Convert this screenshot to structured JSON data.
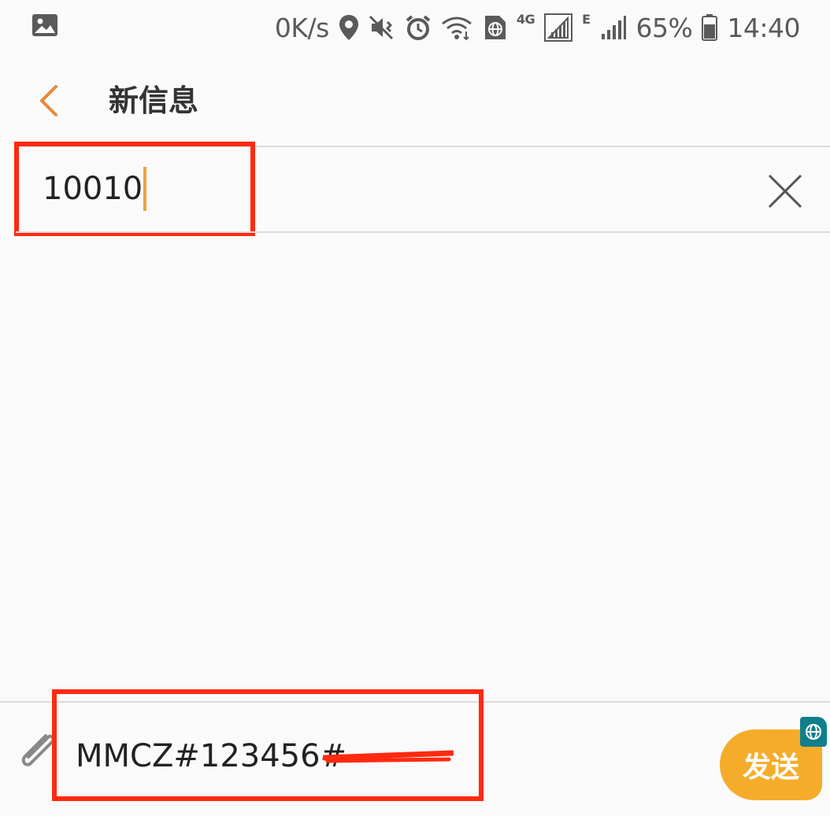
{
  "status_bar": {
    "net_speed": "0K/s",
    "network_4g": "4G",
    "network_e": "E",
    "battery_percent": "65%",
    "time": "14:40",
    "icons": [
      "image-icon",
      "location-icon",
      "vibrate-icon",
      "alarm-icon",
      "wifi-icon",
      "globe-sim-icon",
      "signal-icon",
      "signal-icon-2",
      "battery-icon"
    ]
  },
  "header": {
    "title": "新信息"
  },
  "recipient": {
    "value": "10010"
  },
  "composer": {
    "message_value": "MMCZ#123456#",
    "send_label": "发送"
  },
  "colors": {
    "accent": "#e8883a",
    "send_button": "#f6ac2b",
    "annotation_red": "#ff2a10",
    "sim_badge": "#0f7f8c"
  }
}
